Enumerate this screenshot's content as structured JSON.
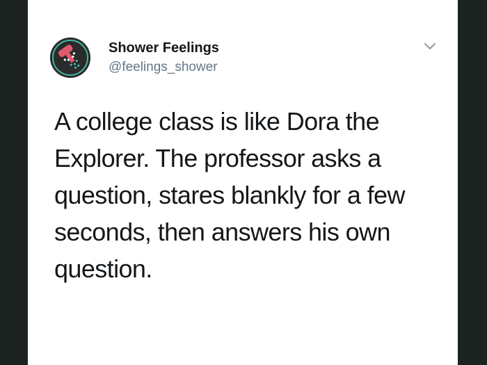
{
  "tweet": {
    "author": {
      "display_name": "Shower Feelings",
      "handle": "@feelings_shower",
      "avatar_icon": "shower-head-avatar-icon"
    },
    "text": "A college class is like Dora the\nExplorer. The professor asks a\nquestion, stares blankly for a few\nseconds, then answers his own\nquestion.",
    "menu_icon": "chevron-down-icon"
  },
  "colors": {
    "background": "#1c2320",
    "card": "#ffffff",
    "text": "#14171a",
    "secondary_text": "#657786",
    "avatar_bg": "#2b2b2b",
    "avatar_accent": "#e05a6a",
    "avatar_teal": "#3fb7a4"
  }
}
